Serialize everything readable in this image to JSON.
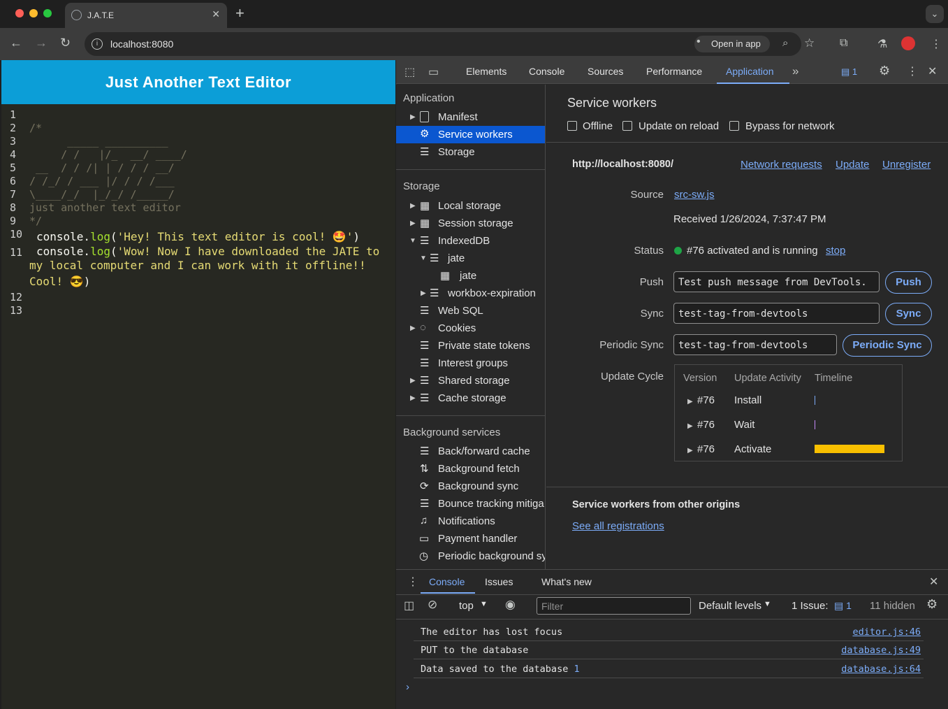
{
  "browser": {
    "tab_title": "J.A.T.E",
    "url": "localhost:8080",
    "open_in_app": "Open in app"
  },
  "app": {
    "header": "Just Another Text Editor",
    "line_numbers": [
      "1",
      "2",
      "3",
      "4",
      "5",
      "6",
      "7",
      "8",
      "9",
      "10",
      "11",
      "12",
      "13"
    ],
    "comment_open": "/*",
    "ascii_art": [
      "      _____ __________",
      "     / /   |/_  __/ ____/",
      " __  / / /| | / / / __/",
      "/ /_/ / ___ |/ / / /___",
      "\\____/_/  |_/_/ /_____/"
    ],
    "comment_tagline": "just another text editor",
    "comment_close": "*/",
    "line10": {
      "obj": "console.",
      "fn": "log",
      "open": "(",
      "str": "'Hey! This text editor is cool! 🤩'",
      "close": ")"
    },
    "line11": {
      "obj": "console.",
      "fn": "log",
      "open": "(",
      "str1": "'Wow! Now I have downloaded the JATE to",
      "str2": "my local computer and I can work with it offline!!",
      "str3": "Cool! 😎",
      "close": ")"
    }
  },
  "devtools": {
    "tabs": [
      "Elements",
      "Console",
      "Sources",
      "Performance",
      "Application"
    ],
    "active_tab": "Application",
    "issues_count": "1",
    "sidebar": {
      "application_title": "Application",
      "application_items": [
        "Manifest",
        "Service workers",
        "Storage"
      ],
      "storage_title": "Storage",
      "storage_items": [
        "Local storage",
        "Session storage",
        "IndexedDB",
        "jate",
        "jate",
        "workbox-expiration",
        "Web SQL",
        "Cookies",
        "Private state tokens",
        "Interest groups",
        "Shared storage",
        "Cache storage"
      ],
      "background_title": "Background services",
      "background_items": [
        "Back/forward cache",
        "Background fetch",
        "Background sync",
        "Bounce tracking mitiga",
        "Notifications",
        "Payment handler",
        "Periodic background sy"
      ]
    },
    "sw": {
      "title": "Service workers",
      "offline": "Offline",
      "update_on_reload": "Update on reload",
      "bypass": "Bypass for network",
      "origin": "http://localhost:8080/",
      "network_requests": "Network requests",
      "update": "Update",
      "unregister": "Unregister",
      "source_label": "Source",
      "source_value": "src-sw.js",
      "received": "Received 1/26/2024, 7:37:47 PM",
      "status_label": "Status",
      "status_value": "#76 activated and is running",
      "stop": "stop",
      "push_label": "Push",
      "push_value": "Test push message from DevTools.",
      "push_btn": "Push",
      "sync_label": "Sync",
      "sync_value": "test-tag-from-devtools",
      "sync_btn": "Sync",
      "periodic_label": "Periodic Sync",
      "periodic_value": "test-tag-from-devtools",
      "periodic_btn": "Periodic Sync",
      "cycle_label": "Update Cycle",
      "cycle_headers": [
        "Version",
        "Update Activity",
        "Timeline"
      ],
      "cycle_rows": [
        {
          "version": "#76",
          "activity": "Install"
        },
        {
          "version": "#76",
          "activity": "Wait"
        },
        {
          "version": "#76",
          "activity": "Activate"
        }
      ],
      "other_title": "Service workers from other origins",
      "see_all": "See all registrations",
      "status_color": "#1ea446",
      "timeline_color": "#f9c000"
    },
    "drawer": {
      "tabs": [
        "Console",
        "Issues",
        "What's new"
      ],
      "active_tab": "Console",
      "context": "top",
      "filter_placeholder": "Filter",
      "levels": "Default levels",
      "issue_label": "1 Issue:",
      "issue_count": "1",
      "hidden": "11 hidden",
      "messages": [
        {
          "text": "The editor has lost focus",
          "count": "",
          "source": "editor.js:46"
        },
        {
          "text": "PUT to the database",
          "count": "",
          "source": "database.js:49"
        },
        {
          "text": "Data saved to the database",
          "count": "1",
          "source": "database.js:64"
        }
      ]
    }
  }
}
